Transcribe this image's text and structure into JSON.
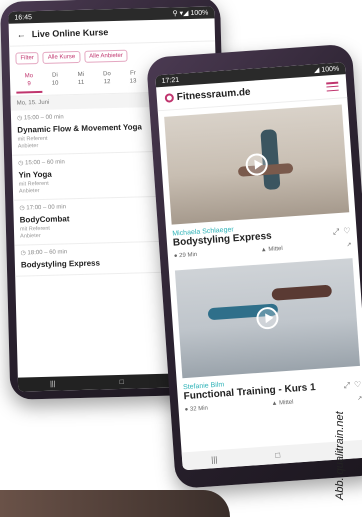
{
  "back_phone": {
    "status": {
      "time": "16:45",
      "right": "⚲ ▾◢ 100%"
    },
    "header": {
      "back_icon": "arrow-left-icon",
      "title": "Live Online Kurse"
    },
    "chips": [
      "Filter",
      "Alle Kurse",
      "Alle Anbieter"
    ],
    "days": [
      {
        "label": "Mo",
        "date": "9"
      },
      {
        "label": "Di",
        "date": "10"
      },
      {
        "label": "Mi",
        "date": "11"
      },
      {
        "label": "Do",
        "date": "12"
      },
      {
        "label": "Fr",
        "date": "13"
      }
    ],
    "day_header": "Mo, 15. Juni",
    "courses": [
      {
        "time": "15:00 – 00 min",
        "name": "Dynamic Flow & Movement Yoga",
        "meta1": "mit Referent",
        "meta2": "Anbieter"
      },
      {
        "time": "15:00 – 60 min",
        "name": "Yin Yoga",
        "meta1": "mit Referent",
        "meta2": "Anbieter"
      },
      {
        "time": "17:00 – 00 min",
        "name": "BodyCombat",
        "meta1": "mit Referent",
        "meta2": "Anbieter"
      },
      {
        "time": "18:00 – 60 min",
        "name": "Bodystyling Express",
        "meta1": "",
        "meta2": ""
      }
    ],
    "nav": [
      "|||",
      "□",
      "<"
    ]
  },
  "front_phone": {
    "status": {
      "time": "17:21",
      "right": "◢ 100%"
    },
    "logo": "Fitnessraum.de",
    "cards": [
      {
        "trainer": "Michaela Schlaeger",
        "title": "Bodystyling Express",
        "duration": "29 Min",
        "level": "Mittel",
        "actions": [
          "⤢",
          "♡"
        ]
      },
      {
        "trainer": "Stefanie Bilm",
        "title": "Functional Training - Kurs 1",
        "duration": "32 Min",
        "level": "Mittel",
        "actions": [
          "⤢",
          "♡"
        ]
      }
    ],
    "nav": [
      "|||",
      "□",
      "<"
    ]
  },
  "credit": "Abb. qualitrain.net"
}
